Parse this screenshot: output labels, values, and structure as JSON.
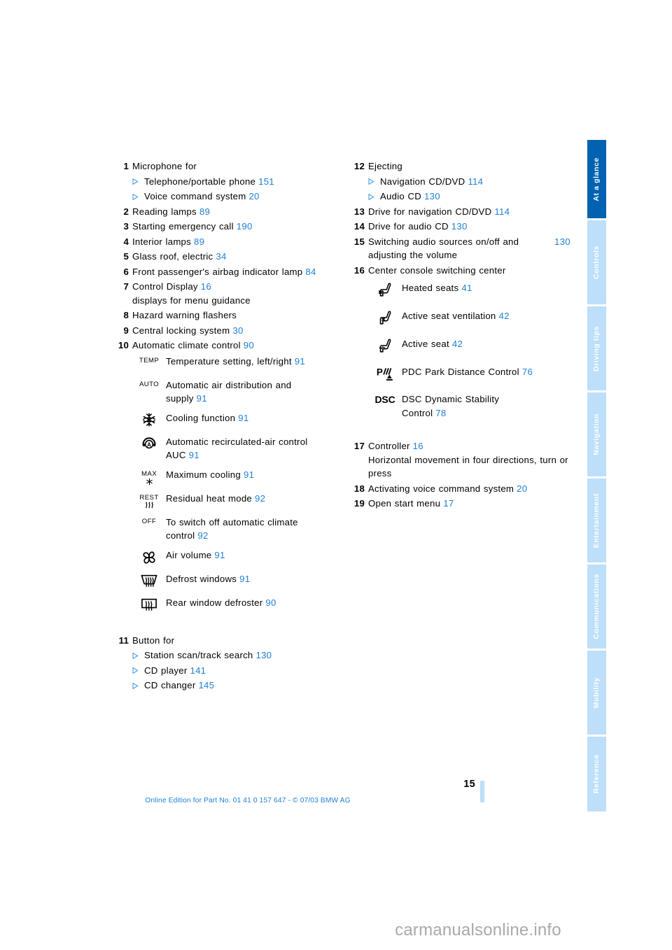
{
  "document": {
    "page_number": "15",
    "footer_note": "Online Edition for Part No. 01 41 0 157 647 - © 07/03 BMW AG",
    "watermark": "carmanualsonline.info"
  },
  "theme": {
    "accent_blue": "#1e7fd6",
    "tab_active": "#0062b0",
    "tab_inactive": "#bddffa",
    "text": "#000000"
  },
  "tabs": [
    {
      "label": "At a glance",
      "active": true
    },
    {
      "label": "Controls",
      "active": false
    },
    {
      "label": "Driving tips",
      "active": false
    },
    {
      "label": "Navigation",
      "active": false
    },
    {
      "label": "Entertainment",
      "active": false
    },
    {
      "label": "Communications",
      "active": false
    },
    {
      "label": "Mobility",
      "active": false
    },
    {
      "label": "Reference",
      "active": false
    }
  ],
  "left_column": {
    "item1": {
      "num": "1",
      "text": "Microphone for"
    },
    "item1_sub1": {
      "text": "Telephone/portable phone",
      "page": "151"
    },
    "item1_sub2": {
      "text": "Voice command system",
      "page": "20"
    },
    "item2": {
      "num": "2",
      "text": "Reading lamps",
      "page": "89"
    },
    "item3": {
      "num": "3",
      "text": "Starting emergency call",
      "page": "190"
    },
    "item4": {
      "num": "4",
      "text": "Interior lamps",
      "page": "89"
    },
    "item5": {
      "num": "5",
      "text": "Glass roof, electric",
      "page": "34"
    },
    "item6": {
      "num": "6",
      "text": "Front passenger's airbag indicator lamp",
      "page": "84"
    },
    "item7": {
      "num": "7",
      "text": "Control Display",
      "page": "16",
      "text2": "displays for menu guidance"
    },
    "item8": {
      "num": "8",
      "text": "Hazard warning flashers"
    },
    "item9": {
      "num": "9",
      "text": "Central locking system",
      "page": "30"
    },
    "item10": {
      "num": "10",
      "text": "Automatic climate control",
      "page": "90"
    },
    "climate_icons": [
      {
        "icon": "temp-label-icon",
        "glyph": "TEMP",
        "label": "Temperature setting, left/right",
        "page": "91"
      },
      {
        "icon": "auto-label-icon",
        "glyph": "AUTO",
        "label": "Automatic air distribution and supply",
        "page": "91"
      },
      {
        "icon": "snowflake-icon",
        "glyph": "",
        "label": "Cooling function",
        "page": "91"
      },
      {
        "icon": "recirculated-air-auc-icon",
        "glyph": "",
        "label": "Automatic recirculated-air control AUC",
        "page": "91"
      },
      {
        "icon": "max-cooling-icon",
        "glyph": "MAX",
        "label": "Maximum cooling",
        "page": "91"
      },
      {
        "icon": "residual-heat-icon",
        "glyph": "REST",
        "label": "Residual heat mode",
        "page": "92"
      },
      {
        "icon": "off-label-icon",
        "glyph": "OFF",
        "label": "To switch off automatic climate control",
        "page": "92"
      },
      {
        "icon": "fan-air-volume-icon",
        "glyph": "",
        "label": "Air volume",
        "page": "91"
      },
      {
        "icon": "defrost-windows-icon",
        "glyph": "",
        "label": "Defrost windows",
        "page": "91"
      },
      {
        "icon": "rear-window-defroster-icon",
        "glyph": "",
        "label": "Rear window defroster",
        "page": "90"
      }
    ],
    "item11": {
      "num": "11",
      "text": "Button for"
    },
    "item11_sub1": {
      "text": "Station scan/track search",
      "page": "130"
    },
    "item11_sub2": {
      "text": "CD player",
      "page": "141"
    },
    "item11_sub3": {
      "text": "CD changer",
      "page": "145"
    }
  },
  "right_column": {
    "item12": {
      "num": "12",
      "text": "Ejecting"
    },
    "item12_sub1": {
      "text": "Navigation CD/DVD",
      "page": "114"
    },
    "item12_sub2": {
      "text": "Audio CD",
      "page": "130"
    },
    "item13": {
      "num": "13",
      "text": "Drive for navigation CD/DVD",
      "page": "114"
    },
    "item14": {
      "num": "14",
      "text": "Drive for audio CD",
      "page": "130"
    },
    "item15": {
      "num": "15",
      "text": "Switching audio sources on/off and adjusting the volume",
      "page": "130"
    },
    "item16": {
      "num": "16",
      "text": "Center console switching center"
    },
    "console_icons": [
      {
        "icon": "heated-seats-icon",
        "glyph": "",
        "label": "Heated seats",
        "page": "41"
      },
      {
        "icon": "seat-ventilation-icon",
        "glyph": "",
        "label": "Active seat ventilation",
        "page": "42"
      },
      {
        "icon": "active-seat-icon",
        "glyph": "",
        "label": "Active seat",
        "page": "42"
      },
      {
        "icon": "pdc-icon",
        "glyph": "",
        "label": "PDC Park Distance Control",
        "page": "76"
      },
      {
        "icon": "dsc-icon",
        "glyph": "DSC",
        "label": "DSC Dynamic Stability Control",
        "page": "78"
      }
    ],
    "item17": {
      "num": "17",
      "text": "Controller",
      "page": "16",
      "text2": "Horizontal movement in four directions, turn or press"
    },
    "item18": {
      "num": "18",
      "text": "Activating voice command system",
      "page": "20"
    },
    "item19": {
      "num": "19",
      "text": "Open start menu",
      "page": "17"
    }
  }
}
